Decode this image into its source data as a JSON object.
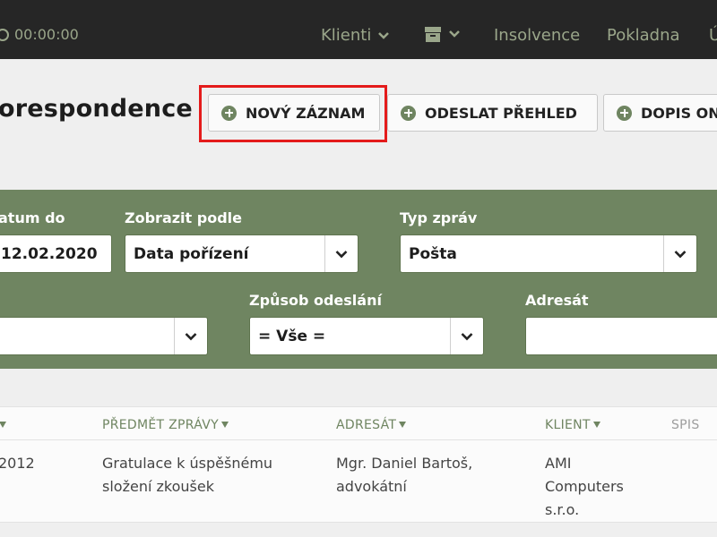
{
  "topbar": {
    "timer": "00:00:00",
    "nav": {
      "klienti": "Klienti",
      "insolvence": "Insolvence",
      "pokladna": "Pokladna",
      "cut": "Ú"
    }
  },
  "page": {
    "title": "orespondence"
  },
  "toolbar": {
    "new_record": "NOVÝ ZÁZNAM",
    "send_overview": "ODESLAT PŘEHLED",
    "letter": "DOPIS ON"
  },
  "filters": {
    "date_to_label": "atum do",
    "date_to_value": "12.02.2020",
    "show_by_label": "Zobrazit podle",
    "show_by_value": "Data pořízení",
    "msg_type_label": "Typ zpráv",
    "msg_type_value": "Pošta",
    "left_select_value": "",
    "send_method_label": "Způsob odeslání",
    "send_method_value": "= Vše =",
    "recipient_label": "Adresát",
    "recipient_value": ""
  },
  "table": {
    "headers": {
      "subject": "PŘEDMĚT ZPRÁVY",
      "recipient": "ADRESÁT",
      "client": "KLIENT",
      "spis": "SPIS"
    },
    "rows": [
      {
        "date": "2012",
        "subject_l1": "Gratulace k úspěšnému",
        "subject_l2": "složení zkoušek",
        "recipient_l1": "Mgr. Daniel Bartoš,",
        "recipient_l2": "advokátní",
        "client_l1": "AMI",
        "client_l2": "Computers",
        "client_l3": "s.r.o."
      }
    ]
  },
  "colors": {
    "topbar": "#262626",
    "nav_text": "#9aa68a",
    "accent_green": "#6f8561",
    "highlight": "#e41b1b",
    "background": "#efefef"
  }
}
